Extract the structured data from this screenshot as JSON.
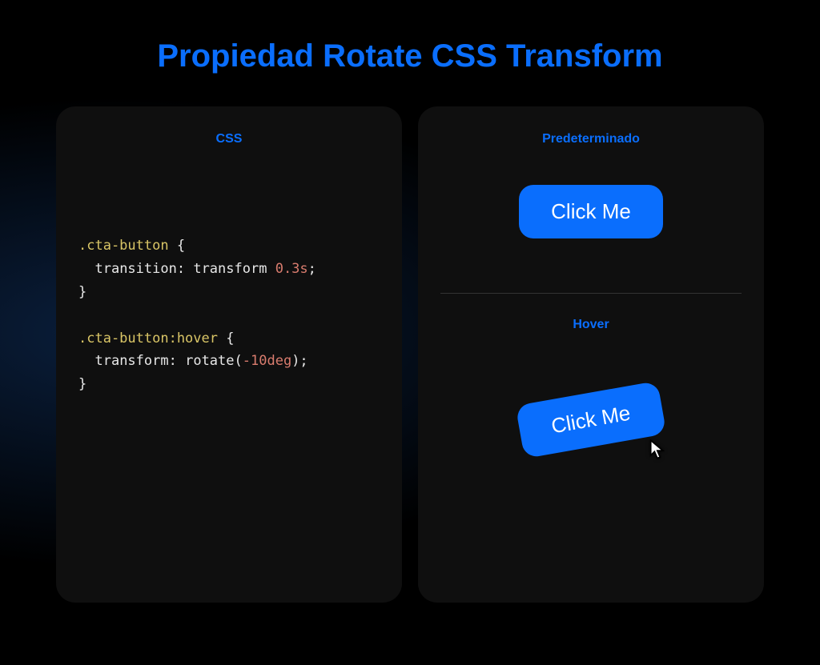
{
  "title": "Propiedad Rotate CSS Transform",
  "leftCard": {
    "label": "CSS",
    "code": {
      "selector1": ".cta-button",
      "prop1": "transition",
      "value1_a": "transform",
      "value1_b": "0.3s",
      "selector2": ".cta-button:hover",
      "prop2": "transform",
      "func2": "rotate",
      "arg2": "-10deg"
    }
  },
  "rightCard": {
    "defaultLabel": "Predeterminado",
    "hoverLabel": "Hover",
    "buttonText": "Click Me"
  },
  "colors": {
    "accent": "#0a6efd",
    "cardBg": "#0f0f0f"
  }
}
